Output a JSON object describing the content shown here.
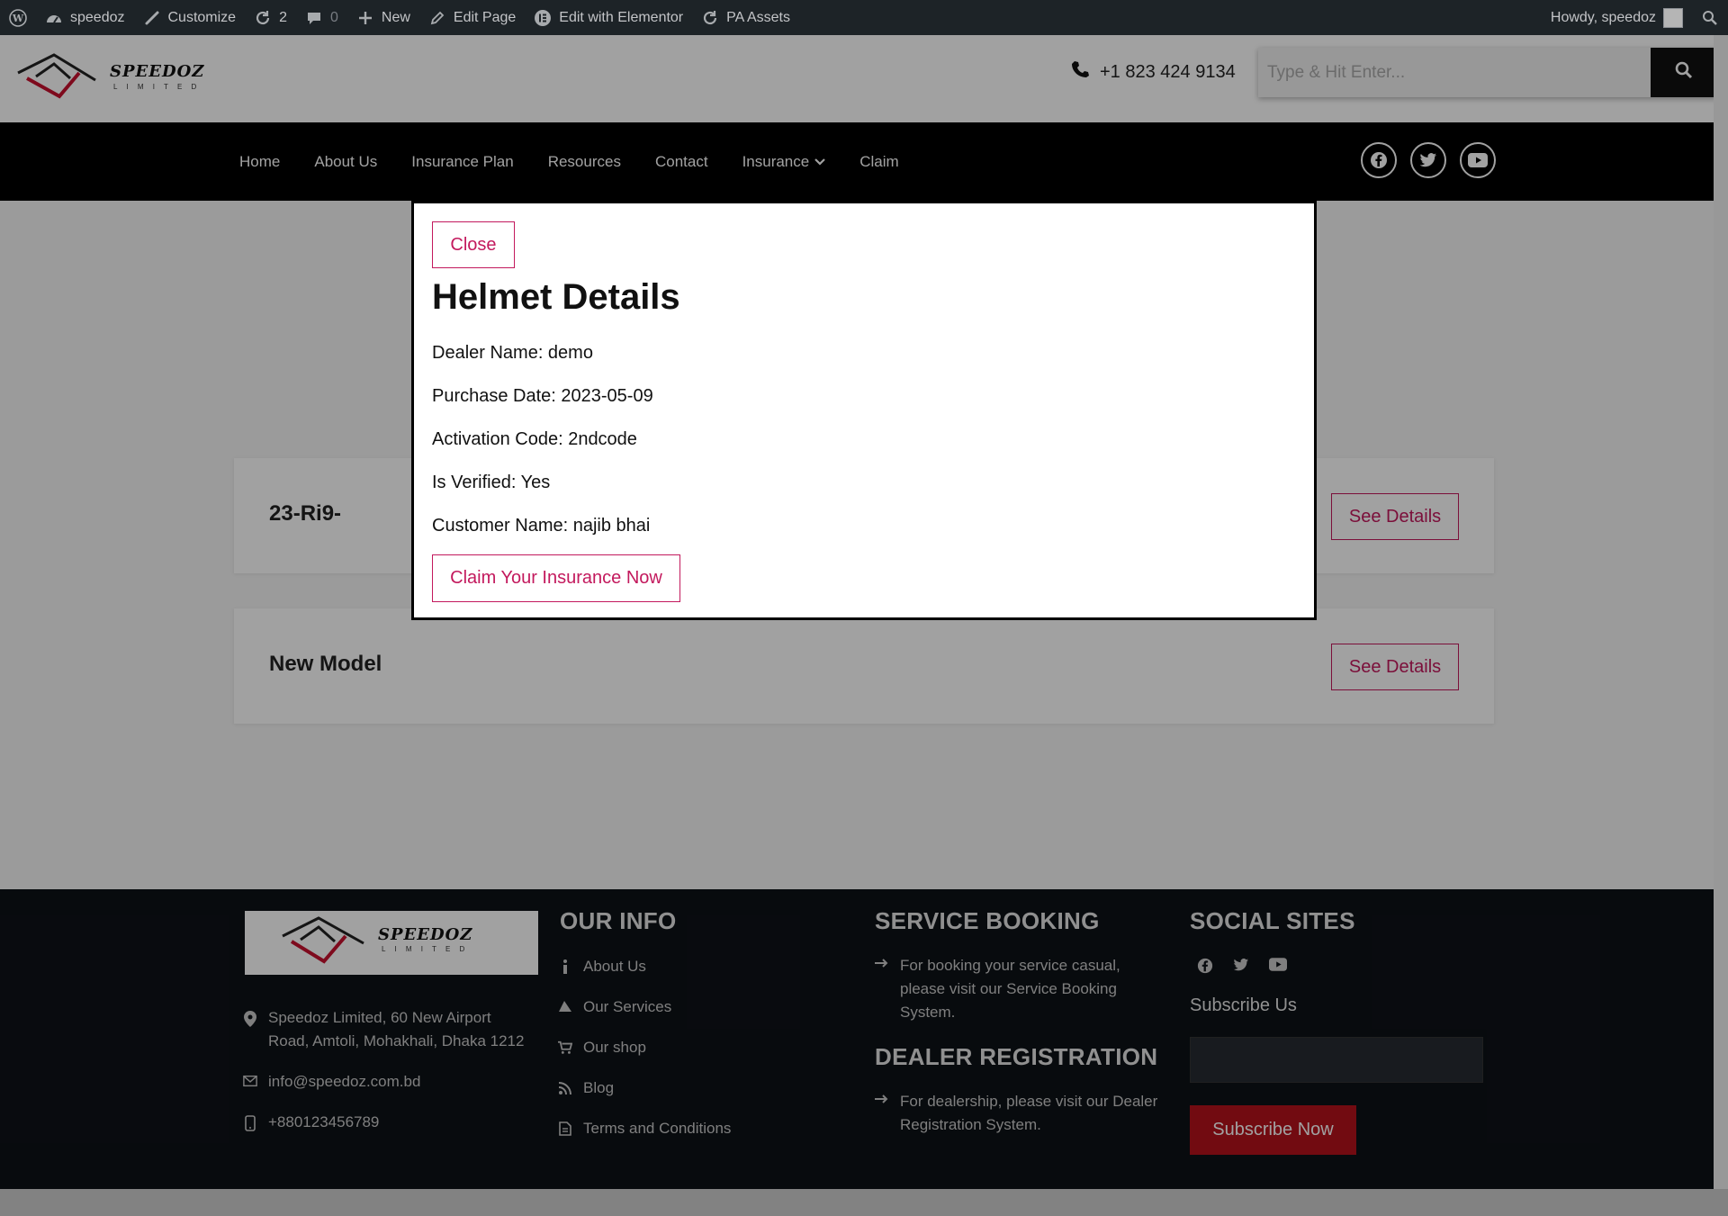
{
  "adminbar": {
    "site_name": "speedoz",
    "customize": "Customize",
    "updates_count": "2",
    "comments_count": "0",
    "new": "New",
    "edit_page": "Edit Page",
    "edit_elementor": "Edit with Elementor",
    "pa_assets": "PA Assets",
    "howdy": "Howdy, speedoz"
  },
  "header": {
    "logo_text": "SPEEDOZ",
    "logo_sub": "L I M I T E D",
    "phone": "+1 823 424 9134",
    "search_placeholder": "Type & Hit Enter..."
  },
  "nav": {
    "items": [
      "Home",
      "About Us",
      "Insurance Plan",
      "Resources",
      "Contact",
      "Insurance",
      "Claim"
    ]
  },
  "cards": [
    {
      "title": "23-Ri9-",
      "button": "See Details"
    },
    {
      "title": "New Model",
      "button": "See Details"
    }
  ],
  "modal": {
    "close": "Close",
    "title": "Helmet Details",
    "dealer": "Dealer Name: demo",
    "purchase": "Purchase Date: 2023-05-09",
    "activation": "Activation Code: 2ndcode",
    "verified": "Is Verified: Yes",
    "customer": "Customer Name: najib bhai",
    "claim": "Claim Your Insurance Now"
  },
  "footer": {
    "address": [
      "Speedoz Limited, 60 New Airport",
      "Road, Amtoli, Mohakhali, Dhaka 1212"
    ],
    "email": "info@speedoz.com.bd",
    "phone": "+880123456789",
    "our_info_title": "OUR INFO",
    "our_info": [
      "About Us",
      "Our Services",
      "Our shop",
      "Blog",
      "Terms and Conditions"
    ],
    "service_title": "SERVICE BOOKING",
    "service_text": [
      "For booking your service casual,",
      "please visit our Service Booking",
      "System."
    ],
    "dealer_title": "DEALER REGISTRATION",
    "dealer_text": [
      "For dealership, please visit our Dealer",
      "Registration System."
    ],
    "social_title": "SOCIAL SITES",
    "subscribe_label": "Subscribe Us",
    "subscribe_button": "Subscribe Now"
  },
  "colors": {
    "accent": "#c3195d",
    "subscribe": "#b5121b",
    "nav_bg": "#000000",
    "footer_bg": "#0e1217"
  }
}
